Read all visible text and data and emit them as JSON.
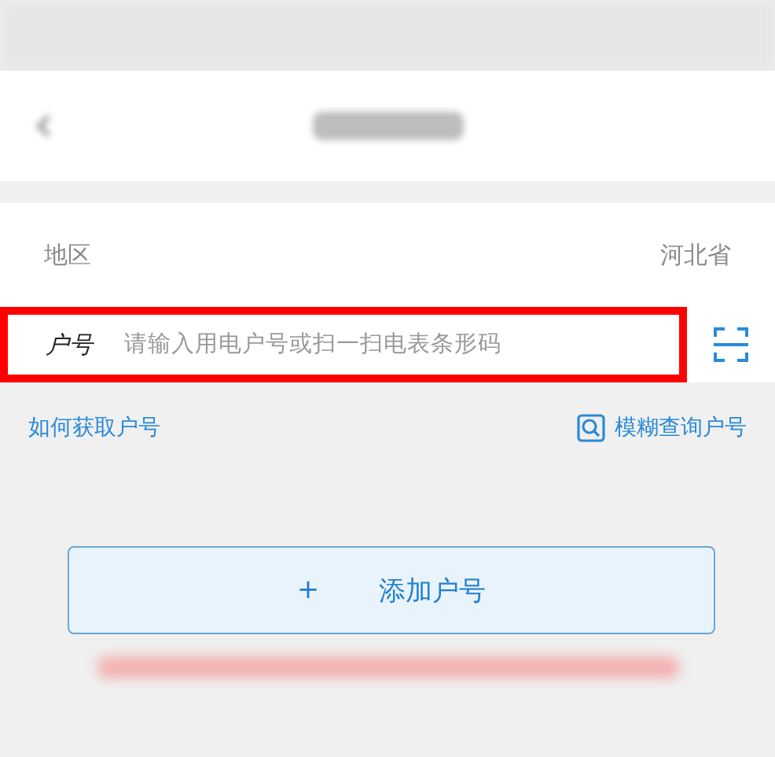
{
  "region_row": {
    "label": "地区",
    "value": "河北省"
  },
  "account_field": {
    "label": "户号",
    "placeholder": "请输入用电户号或扫一扫电表条形码",
    "highlighted": true
  },
  "links": {
    "help": "如何获取户号",
    "search": "模糊查询户号"
  },
  "add_button": {
    "icon": "+",
    "label": "添加户号"
  }
}
